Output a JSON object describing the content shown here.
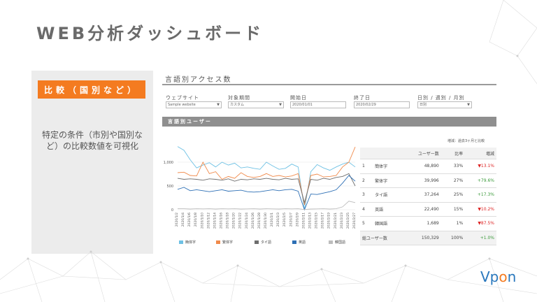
{
  "header": {
    "title": "WEB分析ダッシュボード"
  },
  "side_panel": {
    "badge": "比較（国別など）",
    "description": "特定の条件（市別や国別など）の比較数値を可視化"
  },
  "section": {
    "title": "言語別アクセス数"
  },
  "filters": [
    {
      "label": "ウェブサイト",
      "value": "Sample website"
    },
    {
      "label": "対象期間",
      "value": "カスタム"
    },
    {
      "label": "開始日",
      "value": "2020/01/01"
    },
    {
      "label": "終了日",
      "value": "2020/02/29"
    },
    {
      "label": "日別 / 週別 / 月別",
      "value": "日別"
    }
  ],
  "panel_header": "言語別ユーザー",
  "compare_note": "増減：過去3ヶ月と比較",
  "table": {
    "headers": [
      "",
      "",
      "ユーザー数",
      "比率",
      "増減"
    ],
    "rows": [
      {
        "rank": "1",
        "lang": "簡体字",
        "users": "48,890",
        "ratio": "33%",
        "change": "▼13.1%",
        "dir": "down"
      },
      {
        "rank": "2",
        "lang": "繁体字",
        "users": "39,996",
        "ratio": "27%",
        "change": "+79.6%",
        "dir": "up"
      },
      {
        "rank": "3",
        "lang": "タイ語",
        "users": "37,264",
        "ratio": "25%",
        "change": "+17.3%",
        "dir": "up"
      },
      {
        "rank": "4",
        "lang": "英語",
        "users": "22,490",
        "ratio": "15%",
        "change": "▼10.2%",
        "dir": "down"
      },
      {
        "rank": "5",
        "lang": "韓国語",
        "users": "1,689",
        "ratio": "1%",
        "change": "▼87.5%",
        "dir": "down"
      }
    ],
    "total": {
      "label": "総ユーザー数",
      "users": "150,329",
      "ratio": "100%",
      "change": "+1.0%"
    }
  },
  "chart_data": {
    "type": "line",
    "y_ticks": [
      "1,000",
      "500",
      "0"
    ],
    "ylim": [
      0,
      1500
    ],
    "x_labels": [
      "2020/1/2",
      "2020/1/4",
      "2020/1/6",
      "2020/1/8",
      "2020/1/10",
      "2020/1/12",
      "2020/1/14",
      "2020/1/16",
      "2020/1/18",
      "2020/1/20",
      "2020/1/22",
      "2020/1/24",
      "2020/1/26",
      "2020/1/28",
      "2020/1/30",
      "2020/2/1",
      "2020/2/3",
      "2020/2/5",
      "2020/2/7",
      "2020/2/9",
      "2020/2/11",
      "2020/2/13",
      "2020/2/15",
      "2020/2/17",
      "2020/2/19",
      "2020/2/21",
      "2020/2/23",
      "2020/2/25",
      "2020/2/27"
    ],
    "series": [
      {
        "name": "簡体字",
        "color": "#6ec1e4",
        "values": [
          1330,
          1250,
          1050,
          880,
          940,
          990,
          900,
          1000,
          940,
          980,
          880,
          900,
          870,
          850,
          1000,
          920,
          850,
          870,
          960,
          900,
          0,
          800,
          950,
          880,
          830,
          900,
          960,
          1000,
          900
        ]
      },
      {
        "name": "繁体字",
        "color": "#f08a4b",
        "values": [
          780,
          790,
          720,
          710,
          1000,
          760,
          800,
          640,
          700,
          660,
          780,
          700,
          680,
          700,
          760,
          700,
          720,
          690,
          710,
          760,
          100,
          720,
          750,
          690,
          700,
          720,
          900,
          1000,
          1320
        ]
      },
      {
        "name": "タイ語",
        "color": "#6d6d6d",
        "values": [
          660,
          640,
          650,
          640,
          620,
          650,
          640,
          620,
          650,
          600,
          640,
          630,
          650,
          640,
          660,
          640,
          630,
          660,
          640,
          650,
          150,
          640,
          620,
          660,
          640,
          680,
          700,
          760,
          500
        ]
      },
      {
        "name": "英語",
        "color": "#2d6fb5",
        "values": [
          430,
          470,
          400,
          420,
          400,
          380,
          400,
          420,
          390,
          400,
          410,
          380,
          370,
          380,
          400,
          420,
          400,
          420,
          430,
          390,
          0,
          330,
          320,
          350,
          380,
          420,
          560,
          720,
          600
        ]
      },
      {
        "name": "韓国語",
        "color": "#bdbdbd",
        "values": [
          20,
          20,
          15,
          20,
          18,
          20,
          15,
          20,
          18,
          20,
          15,
          18,
          20,
          15,
          20,
          18,
          15,
          20,
          18,
          20,
          5,
          15,
          18,
          20,
          15,
          20,
          60,
          180,
          150
        ]
      }
    ]
  }
}
